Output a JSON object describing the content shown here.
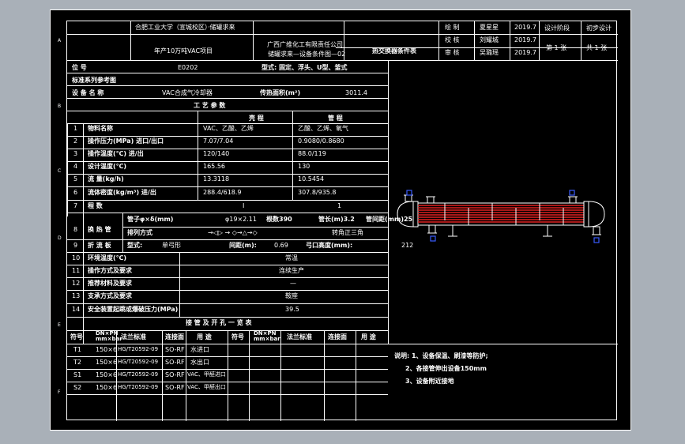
{
  "title_block": {
    "school": "合肥工业大学（宣城校区）·储罐求来",
    "project": "年产10万吨VAC项目",
    "company": "广西广维化工有限责任公司",
    "drawing_no": "储罐求来—设备条件图—02",
    "drawing_name": "热交换器条件表",
    "roles": [
      "绘 制",
      "校 核",
      "审 核"
    ],
    "names": [
      "夏星星",
      "刘耀城",
      "吴璐瑶"
    ],
    "dates": [
      "2019.7",
      "2019.7",
      "2019.7"
    ],
    "stage_label": "设计阶段",
    "stage_value": "初步设计",
    "sheet_no": "第 1 张",
    "sheet_total": "共 1 张"
  },
  "spec": {
    "tag_label": "位 号",
    "tag_value": "E0202",
    "type_label": "型式: 固定、浮头、U型、釜式",
    "std_label": "标准系列参考图",
    "name_label": "设 备 名 称",
    "name_value": "VAC合成气冷却器",
    "area_label": "传热面积(m²)",
    "area_value": "3011.4",
    "section_process": "工 艺 参 数",
    "col_shell": "壳 程",
    "col_tube": "管 程",
    "rows": [
      {
        "no": "1",
        "label": "物料名称",
        "shell": "VAC、乙酸、乙烯",
        "tube": "乙酸、乙烯、氧气"
      },
      {
        "no": "2",
        "label": "操作压力(MPa) 进口/出口",
        "shell": "7.07/7.04",
        "tube": "0.9080/0.8680"
      },
      {
        "no": "3",
        "label": "操作温度(℃) 进/出",
        "shell": "120/140",
        "tube": "88.0/119"
      },
      {
        "no": "4",
        "label": "设计温度(℃)",
        "shell": "165.56",
        "tube": "130"
      },
      {
        "no": "5",
        "label": "流 量(kg/h)",
        "shell": "13.3118",
        "tube": "10.5454"
      },
      {
        "no": "6",
        "label": "流体密度(kg/m³) 进/出",
        "shell": "288.4/618.9",
        "tube": "307.8/935.8"
      },
      {
        "no": "7",
        "label": "程 数",
        "shell": "I",
        "tube": "1"
      }
    ],
    "tube_no": "8",
    "tube_label": "换 热 管",
    "tube_size_label": "管子φ×δ(mm)",
    "tube_size_value": "φ19×2.11",
    "tube_count": "根数390",
    "tube_len": "管长(m)3.2",
    "tube_pitch": "管间距(mm)25",
    "tube_arr_label": "排列方式",
    "tube_arr_symbols": "→◁▷ → ◇→△→◇",
    "tube_arr_value": "转角正三角",
    "baffle_no": "9",
    "baffle_label": "折 流 板",
    "baffle_type": "型式:",
    "baffle_type_value": "单弓形",
    "baffle_gap": "间距(m):",
    "baffle_gap_value": "0.69",
    "baffle_cut": "弓口高度(mm):",
    "baffle_cut_value": "212",
    "extra_rows": [
      {
        "no": "10",
        "label": "环境温度(℃)",
        "value": "常温"
      },
      {
        "no": "11",
        "label": "操作方式及要求",
        "value": "连续生产"
      },
      {
        "no": "12",
        "label": "推荐材料及要求",
        "value": "—"
      },
      {
        "no": "13",
        "label": "支承方式及要求",
        "value": "鞍座"
      },
      {
        "no": "14",
        "label": "安全装置起跳或爆破压力(MPa)",
        "value": "39.5"
      }
    ],
    "nozzle_title": "接 管 及 开 孔 一 览 表",
    "nozzle_headers": [
      "符号",
      "DN×PN mm×bar",
      "法兰标准",
      "连接面",
      "用 途",
      "符号",
      "DN×PN mm×bar",
      "法兰标准",
      "连接面",
      "用 途"
    ],
    "nozzles": [
      {
        "sym": "T1",
        "dn": "150×6",
        "std": "HG/T20592-09",
        "face": "SO-RF",
        "use": "水进口"
      },
      {
        "sym": "T2",
        "dn": "150×6",
        "std": "HG/T20592-09",
        "face": "SO-RF",
        "use": "水出口"
      },
      {
        "sym": "S1",
        "dn": "150×6",
        "std": "HG/T20592-09",
        "face": "SO-RF",
        "use": "VAC、甲醛进口"
      },
      {
        "sym": "S2",
        "dn": "150×6",
        "std": "HG/T20592-09",
        "face": "SO-RF",
        "use": "VAC、甲醛出口"
      }
    ]
  },
  "notes": {
    "title": "说明: 1、设备保温、刷漆等防护;",
    "n2": "2、各接管伸出设备150mm",
    "n3": "3、设备附近接地"
  },
  "colors": {
    "line": "#ffffff",
    "tube": "#e02020",
    "nozzle": "#3a5cff",
    "bg": "#000000",
    "frame": "#a9b0b8"
  }
}
